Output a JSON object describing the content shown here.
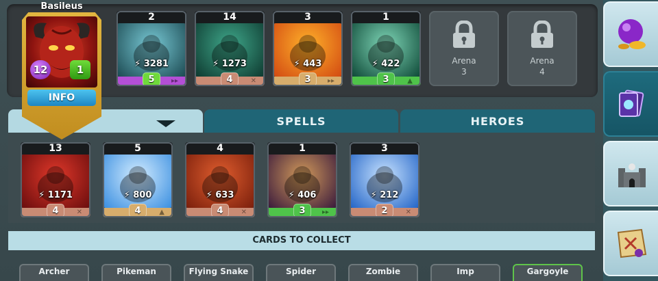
{
  "hero": {
    "name": "Basileus",
    "level": "12",
    "stars": "1",
    "info_label": "INFO"
  },
  "deck": {
    "cards": [
      {
        "count": "2",
        "power": "3281",
        "level": "5",
        "footer_color": "#b44fd6",
        "badge_color": "#6fd93b",
        "art": [
          "#1c4a52",
          "#78c9d5"
        ],
        "icon": "double-arrow-icon"
      },
      {
        "count": "14",
        "power": "1273",
        "level": "4",
        "footer_color": "#c98b74",
        "badge_color": "#c98b74",
        "art": [
          "#0e3a30",
          "#3fa78a"
        ],
        "icon": "swords-icon"
      },
      {
        "count": "3",
        "power": "443",
        "level": "3",
        "footer_color": "#d7ad6c",
        "badge_color": "#d7ad6c",
        "art": [
          "#d24a12",
          "#ffb12a"
        ],
        "icon": "double-arrow-icon"
      },
      {
        "count": "1",
        "power": "422",
        "level": "3",
        "footer_color": "#4fc34a",
        "badge_color": "#4fc34a",
        "art": [
          "#0f4a38",
          "#7fd6b7"
        ],
        "icon": "up-arrow-icon"
      }
    ],
    "locked": [
      {
        "label": "Arena",
        "number": "3"
      },
      {
        "label": "Arena",
        "number": "4"
      }
    ]
  },
  "tabs": {
    "creatures": "",
    "spells": "SPELLS",
    "heroes": "HEROES"
  },
  "collection": [
    {
      "count": "13",
      "power": "1171",
      "level": "4",
      "footer_color": "#c98b74",
      "badge_color": "#c98b74",
      "art": [
        "#6a0d0d",
        "#e1382a"
      ],
      "icon": "swords-icon"
    },
    {
      "count": "5",
      "power": "800",
      "level": "4",
      "footer_color": "#d7ad6c",
      "badge_color": "#d7ad6c",
      "art": [
        "#3b8fe0",
        "#d3ecff"
      ],
      "icon": "up-arrow-icon"
    },
    {
      "count": "4",
      "power": "633",
      "level": "4",
      "footer_color": "#c98b74",
      "badge_color": "#c98b74",
      "art": [
        "#7a1f0c",
        "#e05d2e"
      ],
      "icon": "swords-icon"
    },
    {
      "count": "1",
      "power": "406",
      "level": "3",
      "footer_color": "#4fc34a",
      "badge_color": "#4fc34a",
      "art": [
        "#3a1a3c",
        "#d29a5a"
      ],
      "icon": "double-arrow-icon"
    },
    {
      "count": "3",
      "power": "212",
      "level": "2",
      "footer_color": "#c98b74",
      "badge_color": "#c98b74",
      "art": [
        "#2465c7",
        "#c8e3ff"
      ],
      "icon": "swords-icon"
    }
  ],
  "cards_to_collect": {
    "title": "CARDS TO COLLECT",
    "items": [
      "Archer",
      "Pikeman",
      "Flying Snake",
      "Spider",
      "Zombie",
      "Imp",
      "Gargoyle"
    ]
  },
  "sidebar": [
    "shop-orb-icon",
    "cards-icon",
    "castle-icon",
    "map-icon"
  ]
}
